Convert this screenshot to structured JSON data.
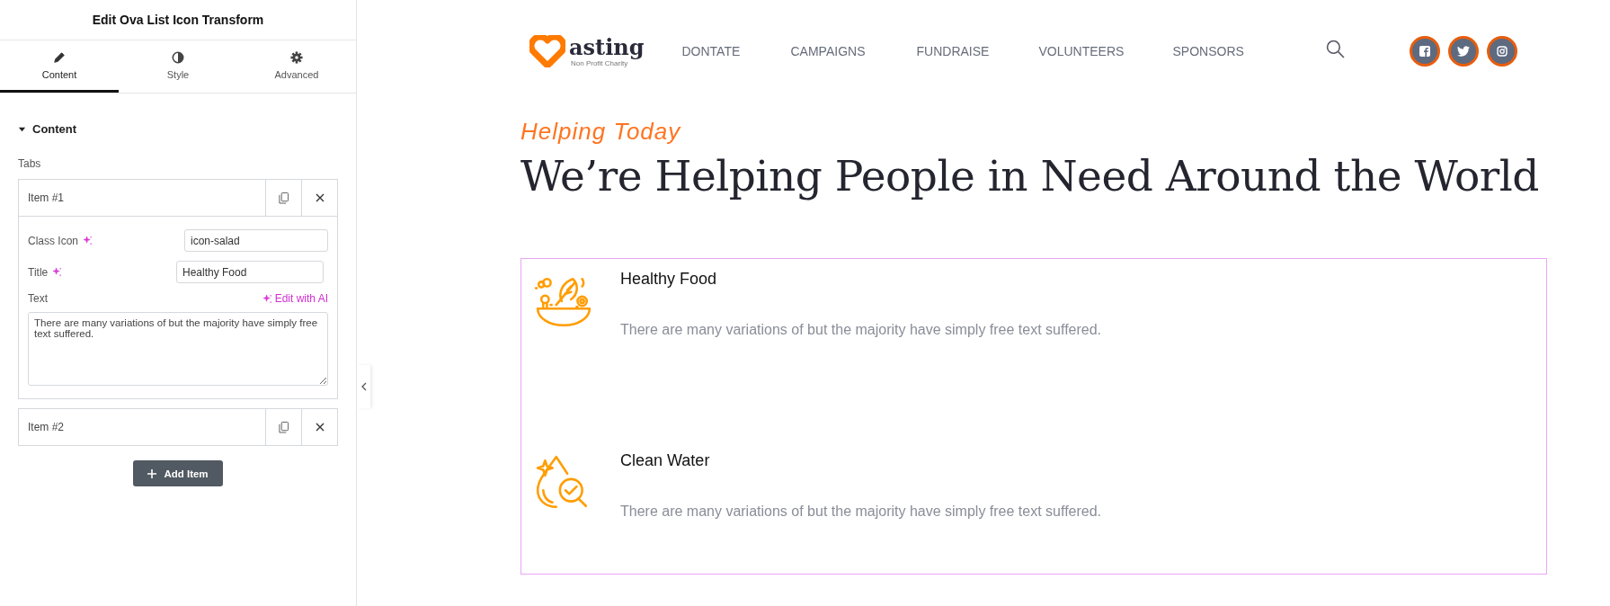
{
  "panel": {
    "title": "Edit Ova List Icon Transform",
    "tabs": [
      {
        "label": "Content",
        "kind": "pencil",
        "selected": true
      },
      {
        "label": "Style",
        "kind": "contrast",
        "selected": false
      },
      {
        "label": "Advanced",
        "kind": "gear",
        "selected": false
      }
    ],
    "section": {
      "title": "Content",
      "expanded": true
    },
    "repeater_label": "Tabs",
    "items": [
      {
        "label": "Item #1",
        "expanded": true,
        "fields": [
          {
            "kind": "input",
            "label": "Class Icon",
            "value": "icon-salad"
          },
          {
            "kind": "input",
            "label": "Title",
            "value": "Healthy Food"
          },
          {
            "kind": "textarea",
            "label": "Text",
            "action": "Edit with AI",
            "value": "There are many variations of but the majority have simply free text suffered."
          }
        ]
      },
      {
        "label": "Item #2",
        "expanded": false
      }
    ],
    "add_button": "Add Item"
  },
  "site": {
    "logo": {
      "name": "asting",
      "tagline": "Non Profit Charity"
    },
    "nav": [
      "DONTATE",
      "CAMPAIGNS",
      "FUNDRAISE",
      "VOLUNTEERS",
      "SPONSORS"
    ],
    "socials": [
      {
        "kind": "facebook"
      },
      {
        "kind": "twitter"
      },
      {
        "kind": "instagram"
      }
    ],
    "subtitle": "Helping Today",
    "heading": "We’re Helping People in Need Around the World",
    "list": [
      {
        "kind": "salad",
        "title": "Healthy Food",
        "text": "There are many variations of but the majority have simply free text suffered."
      },
      {
        "kind": "water",
        "title": "Clean Water",
        "text": "There are many variations of but the majority have simply free text suffered."
      }
    ]
  }
}
